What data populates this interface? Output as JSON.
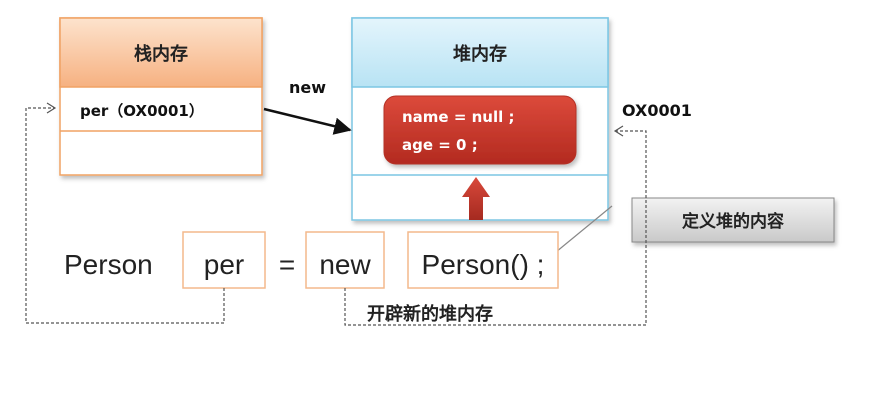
{
  "stack": {
    "title": "栈内存",
    "entry": "per（OX0001）"
  },
  "heap": {
    "title": "堆内存",
    "object_lines": [
      "name = null ;",
      "age = 0 ;"
    ],
    "address": "OX0001"
  },
  "new_arrow_label": "new",
  "callout_label": "定义堆的内容",
  "statement": {
    "type": "Person",
    "var": "per",
    "equals": "=",
    "keyword": "new",
    "constructor": "Person() ;"
  },
  "open_heap_label": "开辟新的堆内存",
  "colors": {
    "stack_header": "#f8b684",
    "heap_header": "#bfe7f6",
    "object_fill": "#c9372c",
    "arrow_red": "#c0392b"
  }
}
